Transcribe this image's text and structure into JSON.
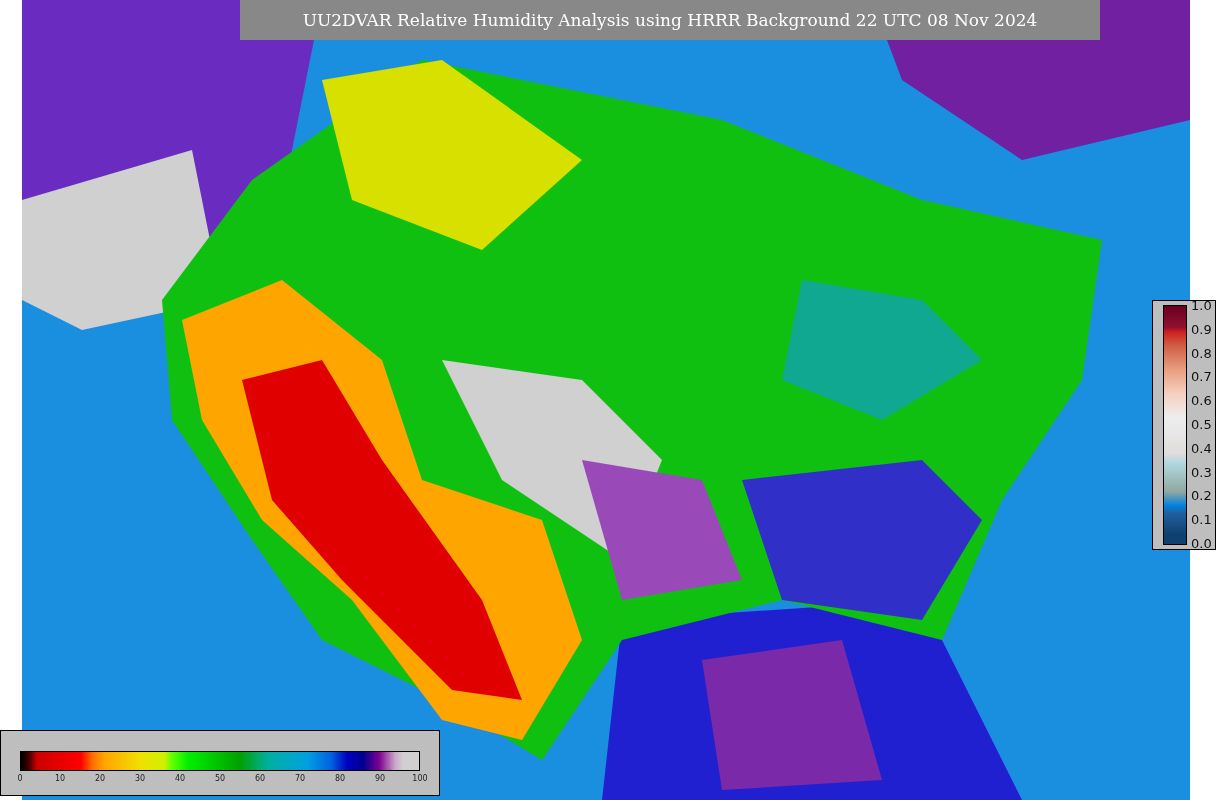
{
  "title": "UU2DVAR Relative Humidity Analysis using HRRR Background 22 UTC 08 Nov 2024",
  "humidity_colorbar": {
    "ticks": [
      "0",
      "10",
      "20",
      "30",
      "40",
      "50",
      "60",
      "70",
      "80",
      "90",
      "100"
    ]
  },
  "station_colorbar": {
    "ticks": [
      "1.0",
      "0.9",
      "0.8",
      "0.7",
      "0.6",
      "0.5",
      "0.4",
      "0.3",
      "0.2",
      "0.1",
      "0.0"
    ]
  }
}
